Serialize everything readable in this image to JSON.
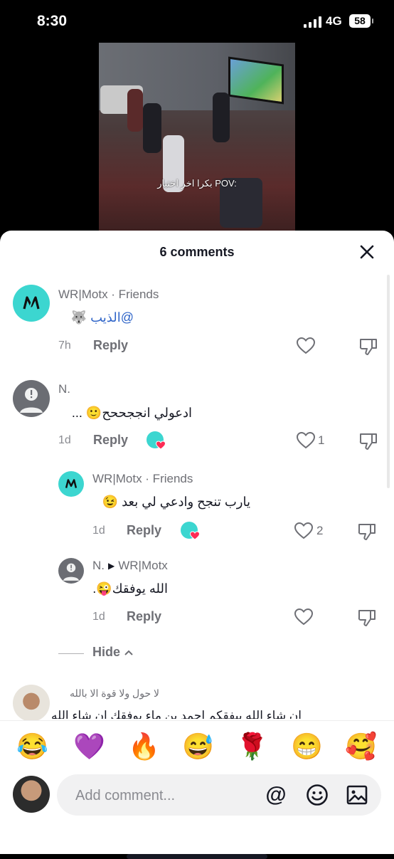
{
  "status_bar": {
    "time": "8:30",
    "network": "4G",
    "battery": "58"
  },
  "video": {
    "caption": "بكرا اخر اختبار POV:"
  },
  "sheet": {
    "title": "6 comments"
  },
  "comments": [
    {
      "username": "WR|Motx · Friends",
      "text": "@الذيب",
      "emoji": "🐺",
      "time": "7h",
      "reply": "Reply",
      "likes": "",
      "creator_liked": false
    },
    {
      "username": "N.",
      "text": "ادعولي انججححح",
      "emoji": "🙂",
      "suffix": "...",
      "time": "1d",
      "reply": "Reply",
      "likes": "1",
      "creator_liked": true
    },
    {
      "username": "WR|Motx · Friends",
      "text": "يارب تنجح وادعي لي بعد",
      "emoji": "😉",
      "time": "1d",
      "reply": "Reply",
      "likes": "2",
      "creator_liked": true
    },
    {
      "username": "N.",
      "reply_to": "WR|Motx",
      "text": "الله يوفقك",
      "emoji": "😜",
      "suffix": ".",
      "time": "1d",
      "reply": "Reply",
      "likes": "",
      "creator_liked": false
    }
  ],
  "hide_label": "Hide",
  "peek_comment": {
    "username": "لا حول ولا قوة الا بالله",
    "text": "ان شاء الله بيفقكم احمد بن ماء يوفقك ان شاء الله"
  },
  "emoji_bar": [
    "😂",
    "💜",
    "🔥",
    "😅",
    "🌹",
    "😁",
    "🥰"
  ],
  "composer": {
    "placeholder": "Add comment..."
  },
  "colors": {
    "accent_teal": "#3cd6d0",
    "like_red": "#fe2c55",
    "mention_blue": "#2e64c8"
  }
}
